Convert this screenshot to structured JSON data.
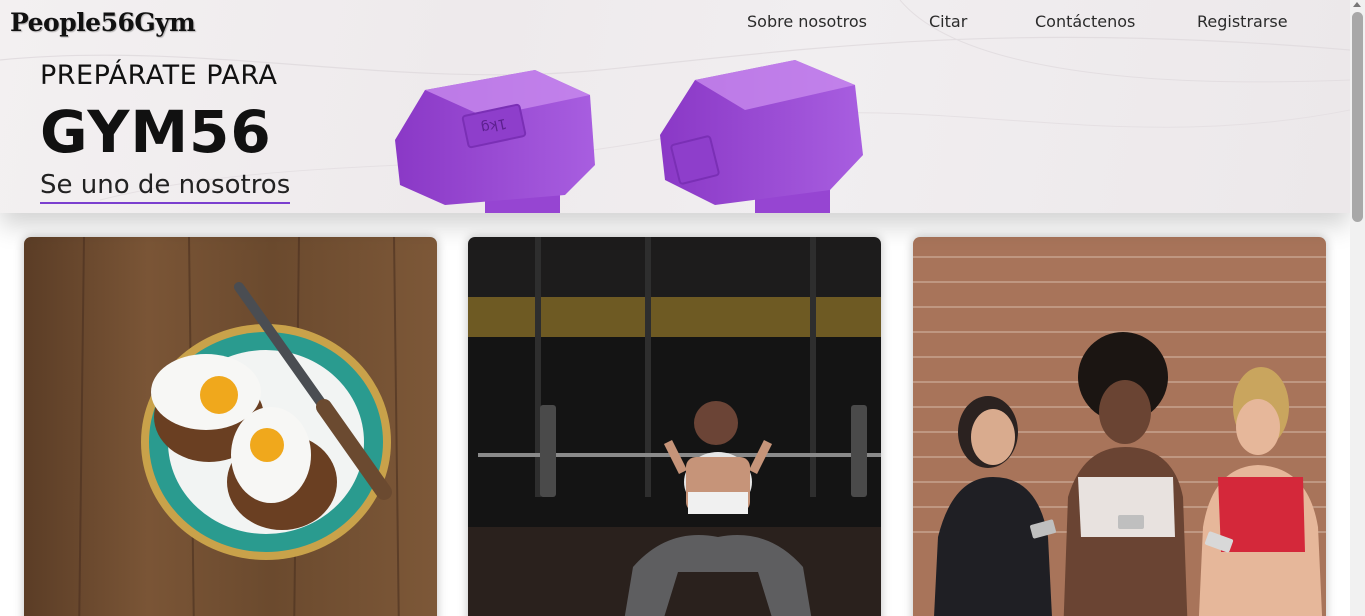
{
  "brand": {
    "logo_text": "People56Gym"
  },
  "nav": {
    "items": [
      {
        "label": "Sobre nosotros"
      },
      {
        "label": "Citar"
      },
      {
        "label": "Contáctenos"
      },
      {
        "label": "Registrarse"
      }
    ]
  },
  "hero": {
    "kicker": "PREPÁRATE PARA",
    "title": "GYM56",
    "cta": "Se uno de nosotros",
    "accent_color": "#7b3fcf",
    "dumbbell_color": "#a050d8"
  },
  "cards": [
    {
      "image": "breakfast-eggs-toast-photo"
    },
    {
      "image": "woman-barbell-squat-photo"
    },
    {
      "image": "three-women-phones-brick-wall-photo"
    }
  ]
}
